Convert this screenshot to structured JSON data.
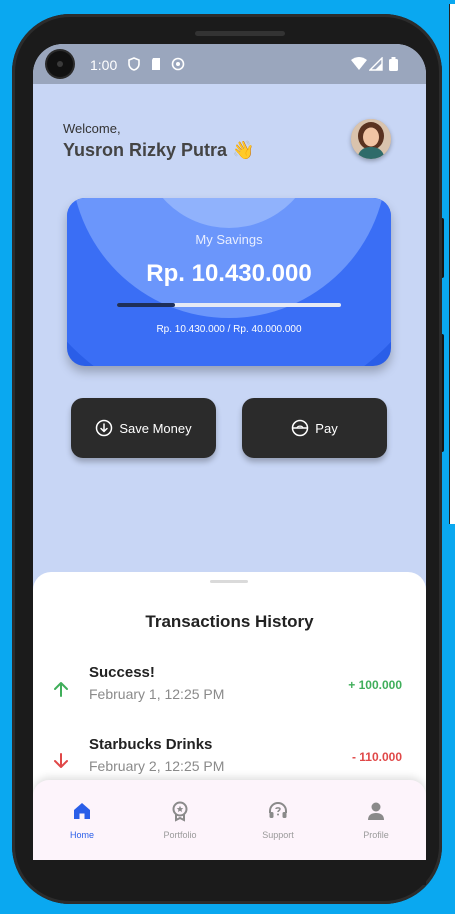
{
  "status_bar": {
    "time": "1:00"
  },
  "header": {
    "welcome": "Welcome,",
    "name": "Yusron Rizky Putra 👋"
  },
  "savings_card": {
    "label": "My Savings",
    "amount": "Rp. 10.430.000",
    "progress_text": "Rp. 10.430.000 / Rp. 40.000.000",
    "progress_fraction": 0.26
  },
  "actions": {
    "save_label": "Save Money",
    "pay_label": "Pay"
  },
  "transactions": {
    "title": "Transactions History",
    "items": [
      {
        "title": "Success!",
        "date": "February 1, 12:25 PM",
        "amount": "+ 100.000",
        "direction": "up"
      },
      {
        "title": "Starbucks Drinks",
        "date": "February 2, 12:25 PM",
        "amount": "- 110.000",
        "direction": "down"
      }
    ]
  },
  "nav": {
    "items": [
      {
        "label": "Home",
        "icon": "home-icon",
        "active": true
      },
      {
        "label": "Portfolio",
        "icon": "award-icon",
        "active": false
      },
      {
        "label": "Support",
        "icon": "headset-icon",
        "active": false
      },
      {
        "label": "Profile",
        "icon": "person-icon",
        "active": false
      }
    ]
  },
  "colors": {
    "background": "#c8d6f5",
    "card_blue": "#2a5ee8",
    "positive": "#3fae5a",
    "negative": "#e04848",
    "button_dark": "#2b2b2b",
    "nav_active": "#2a5ee8"
  }
}
